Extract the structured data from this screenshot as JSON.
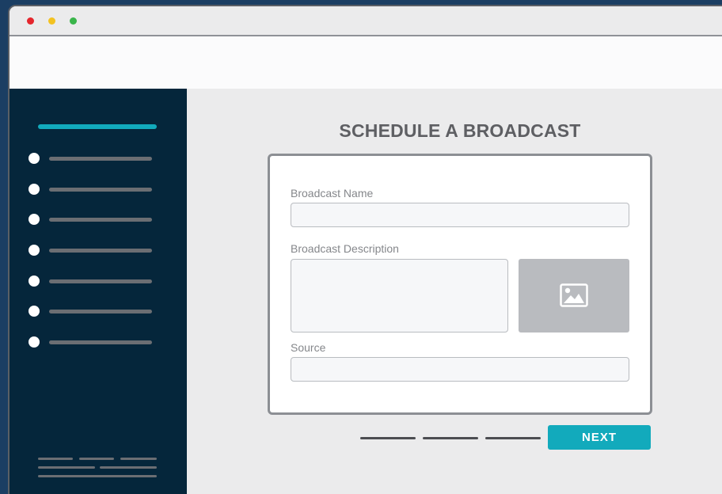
{
  "window": {
    "controls": [
      "close",
      "minimize",
      "maximize"
    ],
    "colors": {
      "close": "#e5262d",
      "minimize": "#f3c221",
      "maximize": "#39b54a"
    }
  },
  "sidebar": {
    "accent_color": "#12aabc",
    "background": "#05263b",
    "item_count": 7
  },
  "main": {
    "title": "SCHEDULE A BROADCAST",
    "form": {
      "name_label": "Broadcast Name",
      "name_value": "",
      "description_label": "Broadcast Description",
      "description_value": "",
      "source_label": "Source",
      "source_value": "",
      "image_icon": "image-icon"
    },
    "next_label": "NEXT",
    "accent_color": "#12aabc"
  }
}
